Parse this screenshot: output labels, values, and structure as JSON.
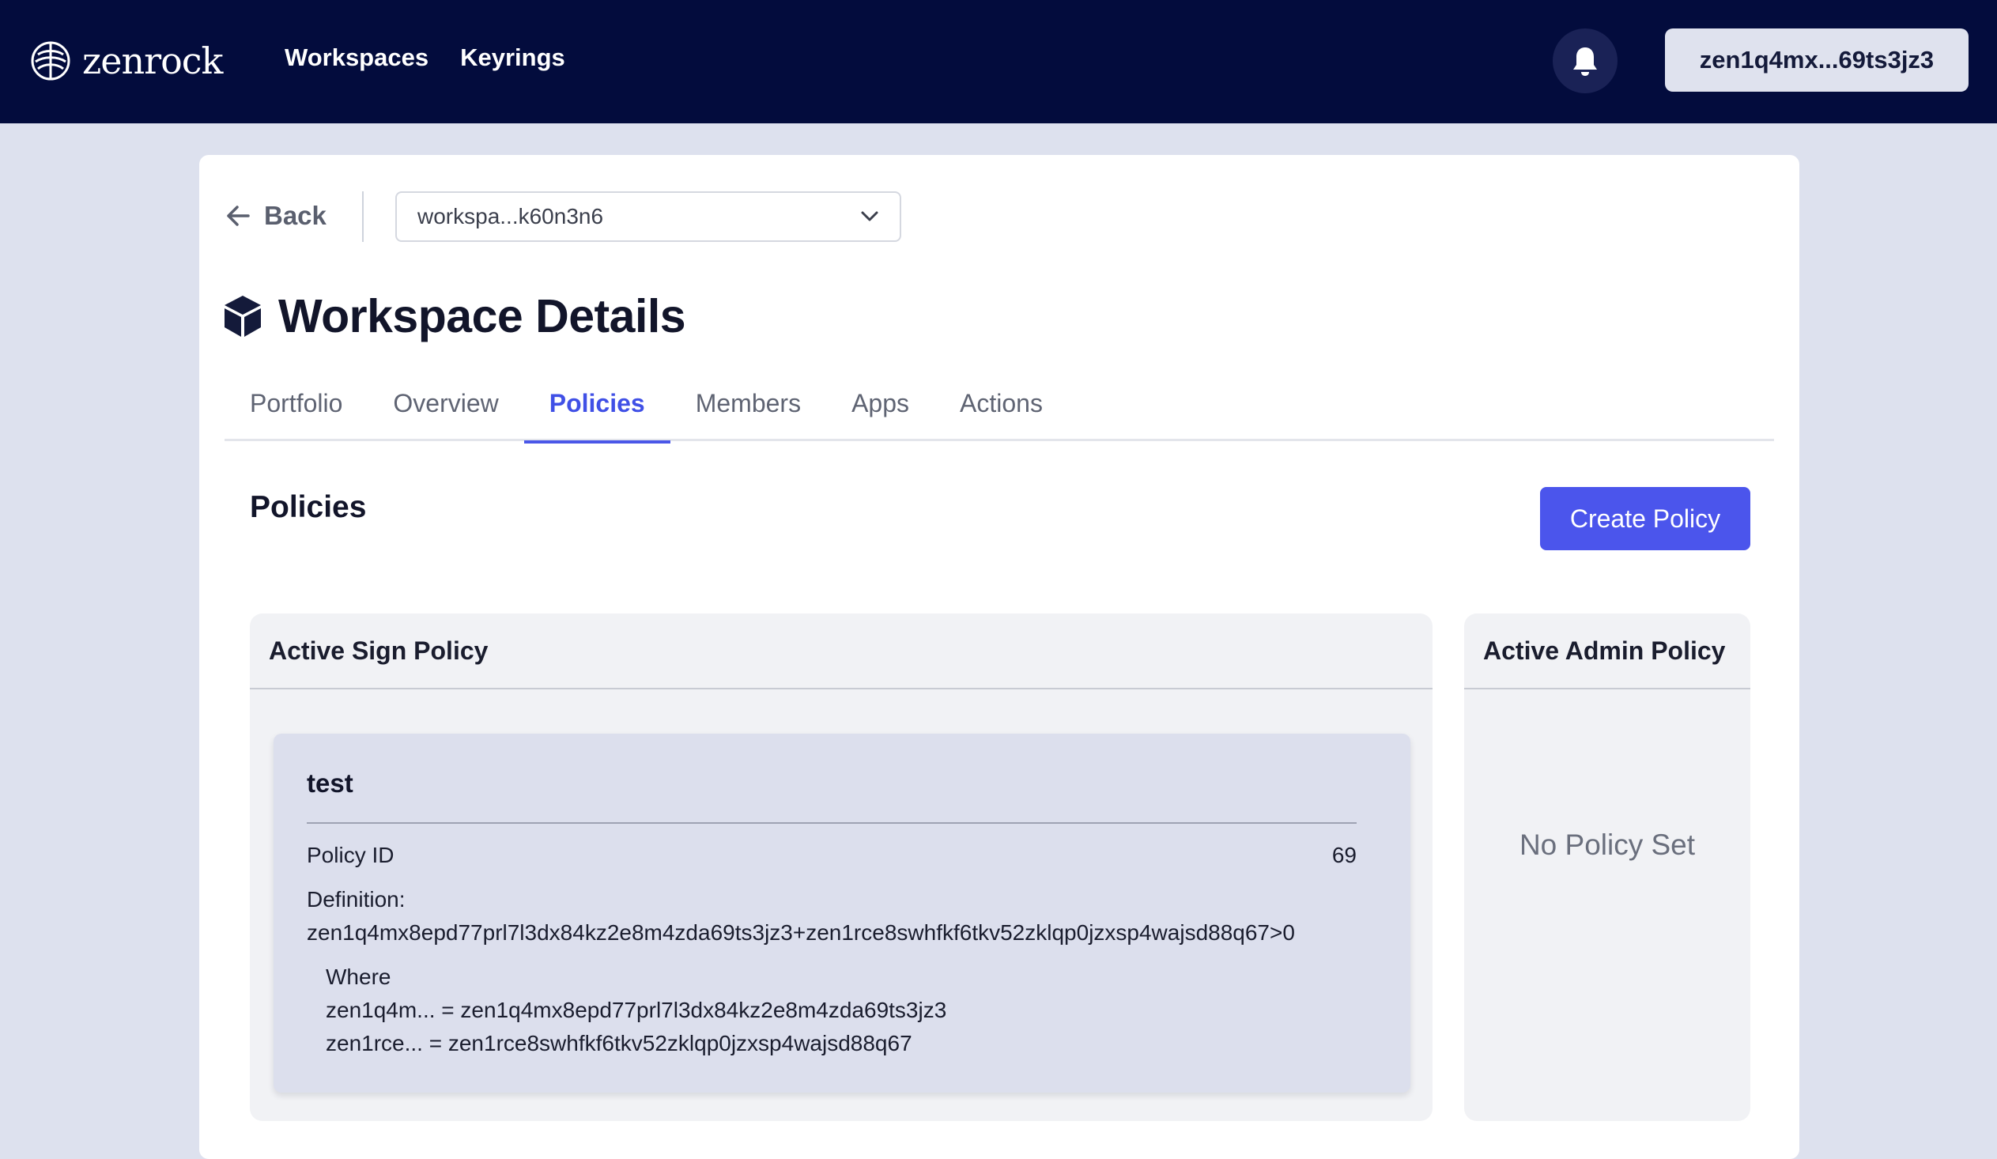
{
  "nav": {
    "logo_text": "zenrock",
    "links": [
      "Workspaces",
      "Keyrings"
    ],
    "wallet_address": "zen1q4mx...69ts3jz3"
  },
  "header": {
    "back_label": "Back",
    "workspace_select_value": "workspa...k60n3n6",
    "page_title": "Workspace Details"
  },
  "tabs": [
    {
      "label": "Portfolio",
      "active": false
    },
    {
      "label": "Overview",
      "active": false
    },
    {
      "label": "Policies",
      "active": true
    },
    {
      "label": "Members",
      "active": false
    },
    {
      "label": "Apps",
      "active": false
    },
    {
      "label": "Actions",
      "active": false
    }
  ],
  "policies": {
    "section_title": "Policies",
    "create_button": "Create Policy",
    "sign_policy": {
      "header": "Active Sign Policy",
      "name": "test",
      "id_label": "Policy ID",
      "id_value": "69",
      "definition_label": "Definition:",
      "definition": "zen1q4mx8epd77prl7l3dx84kz2e8m4zda69ts3jz3+zen1rce8swhfkf6tkv52zklqp0jzxsp4wajsd88q67>0",
      "where_label": "Where",
      "where_lines": [
        "zen1q4m... = zen1q4mx8epd77prl7l3dx84kz2e8m4zda69ts3jz3",
        "zen1rce... = zen1rce8swhfkf6tkv52zklqp0jzxsp4wajsd88q67"
      ]
    },
    "admin_policy": {
      "header": "Active Admin Policy",
      "empty_text": "No Policy Set"
    }
  },
  "colors": {
    "nav_bg": "#030c3d",
    "accent": "#4b55ec",
    "page_bg": "#dde1ee"
  }
}
